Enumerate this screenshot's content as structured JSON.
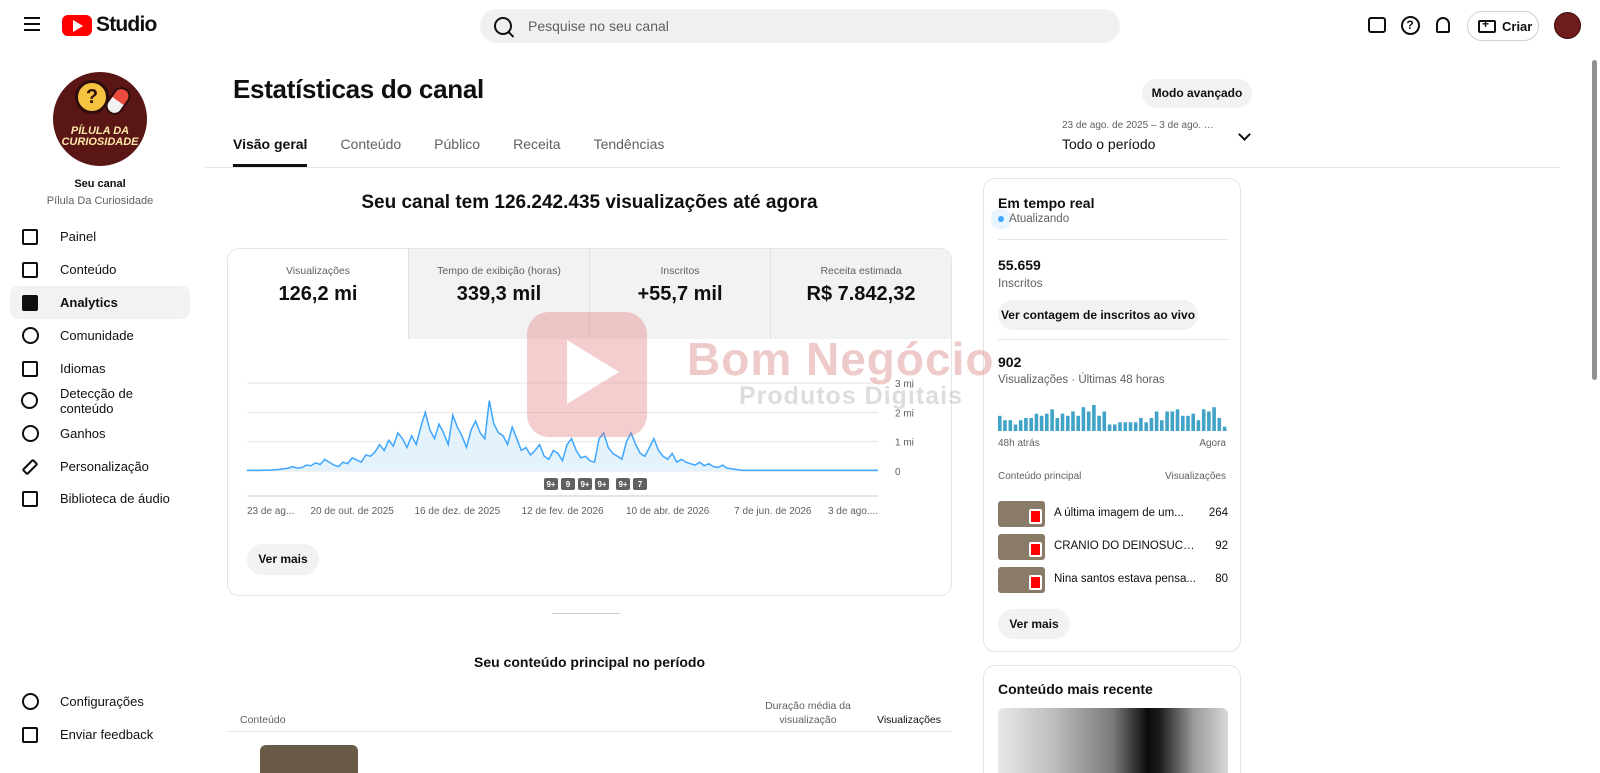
{
  "header": {
    "logo_text": "Studio",
    "search_placeholder": "Pesquise no seu canal",
    "create_label": "Criar"
  },
  "sidebar": {
    "channel_avatar_text": "PÍLULA DA CURIOSIDADE",
    "title": "Seu canal",
    "channel_name": "Pílula Da Curiosidade",
    "items": [
      {
        "label": "Painel",
        "icon": "dashboard-icon"
      },
      {
        "label": "Conteúdo",
        "icon": "content-icon"
      },
      {
        "label": "Analytics",
        "icon": "analytics-icon",
        "active": true
      },
      {
        "label": "Comunidade",
        "icon": "community-icon"
      },
      {
        "label": "Idiomas",
        "icon": "subtitles-icon"
      },
      {
        "label": "Detecção de conteúdo",
        "icon": "copyright-icon"
      },
      {
        "label": "Ganhos",
        "icon": "dollar-icon"
      },
      {
        "label": "Personalização",
        "icon": "magic-wand-icon"
      },
      {
        "label": "Biblioteca de áudio",
        "icon": "audio-library-icon"
      }
    ],
    "bottom_items": [
      {
        "label": "Configurações",
        "icon": "settings-icon"
      },
      {
        "label": "Enviar feedback",
        "icon": "feedback-icon"
      }
    ]
  },
  "page": {
    "title": "Estatísticas do canal",
    "advanced_mode_label": "Modo avançado",
    "tabs": [
      "Visão geral",
      "Conteúdo",
      "Público",
      "Receita",
      "Tendências"
    ],
    "active_tab": "Visão geral",
    "period_range": "23 de ago. de 2025 – 3 de ago. d...",
    "period_label": "Todo o período"
  },
  "overview": {
    "headline": "Seu canal tem 126.242.435 visualizações até agora",
    "metrics": [
      {
        "label": "Visualizações",
        "value": "126,2 mi"
      },
      {
        "label": "Tempo de exibição (horas)",
        "value": "339,3 mil"
      },
      {
        "label": "Inscritos",
        "value": "+55,7 mil"
      },
      {
        "label": "Receita estimada",
        "value": "R$ 7.842,32"
      }
    ],
    "see_more_label": "Ver mais"
  },
  "chart_data": {
    "type": "area",
    "series": [
      {
        "values": [
          0.02,
          0.02,
          0.02,
          0.02,
          0.03,
          0.03,
          0.04,
          0.05,
          0.08,
          0.1,
          0.15,
          0.1,
          0.12,
          0.2,
          0.18,
          0.28,
          0.22,
          0.4,
          0.3,
          0.2,
          0.15,
          0.3,
          0.25,
          0.45,
          0.38,
          0.3,
          0.55,
          0.5,
          0.65,
          0.9,
          0.7,
          1.05,
          0.85,
          1.3,
          1.1,
          0.8,
          1.2,
          0.9,
          1.5,
          2.0,
          1.4,
          1.1,
          1.6,
          1.3,
          0.9,
          1.9,
          1.5,
          1.2,
          0.8,
          1.4,
          1.7,
          1.3,
          1.1,
          2.4,
          1.6,
          1.3,
          1.2,
          0.9,
          1.5,
          1.1,
          0.7,
          0.8,
          0.55,
          0.7,
          0.9,
          0.5,
          0.4,
          0.7,
          0.6,
          0.35,
          0.9,
          1.1,
          0.7,
          0.45,
          0.5,
          0.35,
          0.3,
          1.1,
          1.3,
          0.8,
          0.6,
          0.5,
          0.4,
          1.0,
          1.3,
          0.9,
          0.6,
          0.5,
          0.8,
          1.1,
          0.7,
          0.5,
          0.4,
          0.6,
          0.3,
          0.4,
          0.3,
          0.25,
          0.2,
          0.3,
          0.18,
          0.25,
          0.15,
          0.12,
          0.2,
          0.1,
          0.08,
          0.05,
          0.03,
          0.02,
          0.02,
          0.02,
          0.02,
          0.02,
          0.02,
          0.02,
          0.02,
          0.02,
          0.02,
          0.02,
          0.02,
          0.02,
          0.02,
          0.02,
          0.02,
          0.02,
          0.02,
          0.02,
          0.02,
          0.02,
          0.02,
          0.02,
          0.02,
          0.02,
          0.02,
          0.02,
          0.02,
          0.02,
          0.02
        ]
      }
    ],
    "x_tick_labels": [
      "23 de ag...",
      "20 de out. de 2025",
      "16 de dez. de 2025",
      "12 de fev. de 2026",
      "10 de abr. de 2026",
      "7 de jun. de 2026",
      "3 de ago...."
    ],
    "y_tick_labels": [
      "0",
      "1 mi",
      "2 mi",
      "3 mi"
    ],
    "ylim": [
      0,
      3
    ],
    "markers": [
      "9+",
      "9",
      "9+",
      "9+",
      "9+",
      "7"
    ],
    "color": "#3ea6ff",
    "fill_color": "#e3f2fb"
  },
  "top_content": {
    "title": "Seu conteúdo principal no período",
    "col_content": "Conteúdo",
    "col_avg_duration": "Duração média da visualização",
    "col_views": "Visualizações"
  },
  "realtime": {
    "title": "Em tempo real",
    "status": "Atualizando",
    "subscribers": "55.659",
    "subscribers_label": "Inscritos",
    "live_count_button": "Ver contagem de inscritos ao vivo",
    "views": "902",
    "views_label": "Visualizações · Últimas 48 horas",
    "bars": [
      7,
      5,
      5,
      3,
      5,
      6,
      6,
      8,
      7,
      8,
      10,
      6,
      8,
      7,
      9,
      7,
      11,
      9,
      12,
      7,
      9,
      3,
      3,
      4,
      4,
      4,
      4,
      6,
      4,
      6,
      9,
      5,
      9,
      9,
      10,
      7,
      7,
      8,
      5,
      10,
      9,
      11,
      6,
      2
    ],
    "axis_left": "48h atrás",
    "axis_right": "Agora",
    "col_content": "Conteúdo principal",
    "col_views": "Visualizações",
    "rows": [
      {
        "title": "A última imagem de um...",
        "views": "264"
      },
      {
        "title": "CRÂNIO DO DEINOSUCHU...",
        "views": "92"
      },
      {
        "title": "Nina santos estava pensa...",
        "views": "80"
      }
    ],
    "see_more_label": "Ver mais"
  },
  "recent": {
    "title": "Conteúdo mais recente"
  },
  "watermark": {
    "line1": "Bom Negócio",
    "line2": "Produtos Digitais"
  }
}
